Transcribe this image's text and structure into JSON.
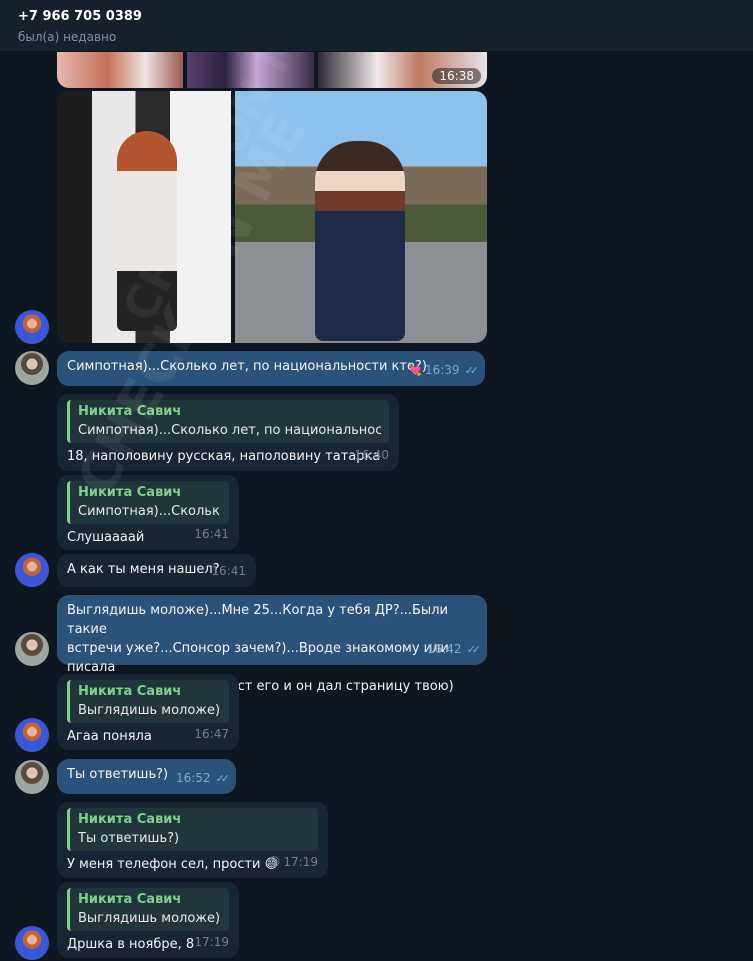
{
  "header": {
    "phone": "+7 966 705 0389",
    "status": "был(а) недавно"
  },
  "watermark": "CHECK ON ME",
  "photos": {
    "top_time": "16:38"
  },
  "messages": [
    {
      "id": "m1",
      "dir": "out",
      "text": "Симпотная)...Сколько лет, по национальности кто?)",
      "time": "16:39",
      "reaction": "💘"
    },
    {
      "id": "m2",
      "dir": "in",
      "quote_name": "Никита Савич",
      "quote_text": "Симпотная)...Сколько лет, по национальности ...",
      "text": "18, наполовину русская, наполовину татарка",
      "time": "16:40"
    },
    {
      "id": "m3",
      "dir": "in",
      "quote_name": "Никита Савич",
      "quote_text": "Симпотная)...Скольк...",
      "text": "Слушаааай",
      "time": "16:41"
    },
    {
      "id": "m4",
      "dir": "in",
      "text": "А как ты меня нашел?",
      "time": "16:41"
    },
    {
      "id": "m5",
      "dir": "out",
      "text": "Выглядишь моложе)...Мне 25...Когда у тебя ДР?...Были такие\nвстречи уже?...Спонсор зачем?)...Вроде знакомому или писала\nили лайкала какой то пост его и он дал страницу твою)",
      "time": "16:42"
    },
    {
      "id": "m6",
      "dir": "in",
      "quote_name": "Никита Савич",
      "quote_text": "Выглядишь моложе)....",
      "text": "Агаа поняла",
      "time": "16:47"
    },
    {
      "id": "m7",
      "dir": "out",
      "text": "Ты ответишь?)",
      "time": "16:52"
    },
    {
      "id": "m8",
      "dir": "in",
      "quote_name": "Никита Савич",
      "quote_text": "Ты ответишь?)",
      "text": "У меня телефон сел, прости",
      "emoji": "😅",
      "reaction": "😁",
      "time": "17:19"
    },
    {
      "id": "m9",
      "dir": "in",
      "quote_name": "Никита Савич",
      "quote_text": "Выглядишь моложе)....",
      "text": "Дршка в ноябре, 8",
      "time": "17:19"
    }
  ]
}
